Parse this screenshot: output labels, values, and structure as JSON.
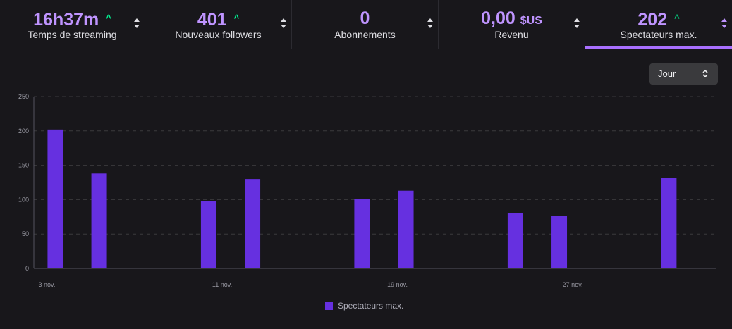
{
  "tabs": [
    {
      "value": "16h37m",
      "unit": "",
      "trend": "^",
      "label": "Temps de streaming",
      "active": false
    },
    {
      "value": "401",
      "unit": "",
      "trend": "^",
      "label": "Nouveaux followers",
      "active": false
    },
    {
      "value": "0",
      "unit": "",
      "trend": "",
      "label": "Abonnements",
      "active": false
    },
    {
      "value": "0,00",
      "unit": "$US",
      "trend": "",
      "label": "Revenu",
      "active": false
    },
    {
      "value": "202",
      "unit": "",
      "trend": "^",
      "label": "Spectateurs max.",
      "active": true
    }
  ],
  "period_select": {
    "value": "Jour"
  },
  "colors": {
    "bar": "#6630e0",
    "accent": "#bf94ff",
    "trend_up": "#00f593"
  },
  "chart_data": {
    "type": "bar",
    "title": "",
    "xlabel": "",
    "ylabel": "",
    "ylim": [
      0,
      250
    ],
    "yticks": [
      0,
      50,
      100,
      150,
      200,
      250
    ],
    "grid": true,
    "legend": "bottom-center",
    "xticks": [
      {
        "label": "3 nov.",
        "day": 3
      },
      {
        "label": "11 nov.",
        "day": 11
      },
      {
        "label": "19 nov.",
        "day": 19
      },
      {
        "label": "27 nov.",
        "day": 27
      }
    ],
    "series": [
      {
        "name": "Spectateurs max.",
        "points": [
          {
            "day": 3,
            "value": 202
          },
          {
            "day": 5,
            "value": 138
          },
          {
            "day": 10,
            "value": 98
          },
          {
            "day": 12,
            "value": 130
          },
          {
            "day": 17,
            "value": 101
          },
          {
            "day": 19,
            "value": 113
          },
          {
            "day": 24,
            "value": 80
          },
          {
            "day": 26,
            "value": 76
          },
          {
            "day": 31,
            "value": 132
          }
        ]
      }
    ]
  }
}
